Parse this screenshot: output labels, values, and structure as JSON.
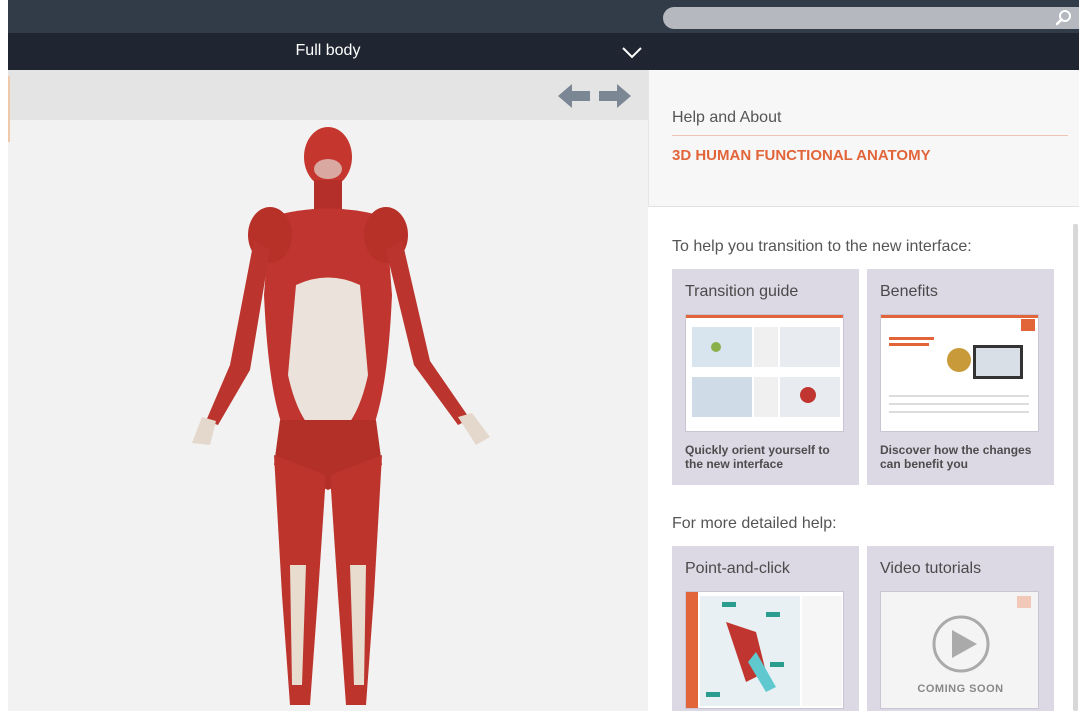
{
  "view_selector": {
    "label": "Full body"
  },
  "search": {
    "placeholder": ""
  },
  "about": {
    "title": "Help and About",
    "product": "3D HUMAN FUNCTIONAL ANATOMY"
  },
  "transition": {
    "heading": "To help you transition to the new interface:",
    "cards": [
      {
        "title": "Transition guide",
        "description": "Quickly orient yourself to the new interface"
      },
      {
        "title": "Benefits",
        "description": "Discover how the changes can benefit you"
      }
    ]
  },
  "detailed": {
    "heading": "For more detailed help:",
    "cards": [
      {
        "title": "Point-and-click",
        "description": ""
      },
      {
        "title": "Video tutorials",
        "badge": "COMING SOON"
      }
    ]
  },
  "colors": {
    "accent": "#e2653a",
    "header": "#1f2631",
    "card_bg": "#dcd8e4"
  }
}
